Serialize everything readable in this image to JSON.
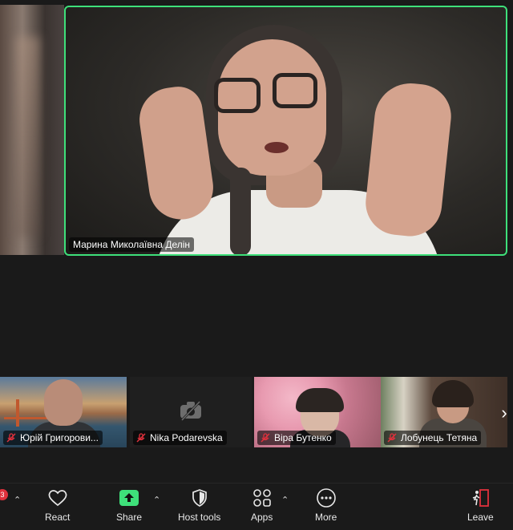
{
  "speaker": {
    "name": "Марина Миколаївна Делін"
  },
  "participants": [
    {
      "name": "Юрій Григорови..."
    },
    {
      "name": "Nika Podarevska"
    },
    {
      "name": "Віра Бутенко"
    },
    {
      "name": "Лобунець Тетяна"
    }
  ],
  "toolbar": {
    "badge_count": "3",
    "react_label": "React",
    "share_label": "Share",
    "host_tools_label": "Host tools",
    "apps_label": "Apps",
    "more_label": "More",
    "leave_label": "Leave"
  },
  "colors": {
    "active_speaker_border": "#3ee07a",
    "share_green": "#3ee07a",
    "leave_red": "#e0313c",
    "mic_off_red": "#e0313c"
  },
  "icons": [
    "camera-off-icon",
    "mic-off-icon",
    "heart-icon",
    "share-arrow-icon",
    "shield-icon",
    "apps-icon",
    "more-icon",
    "leave-icon",
    "chevron-right-icon"
  ]
}
